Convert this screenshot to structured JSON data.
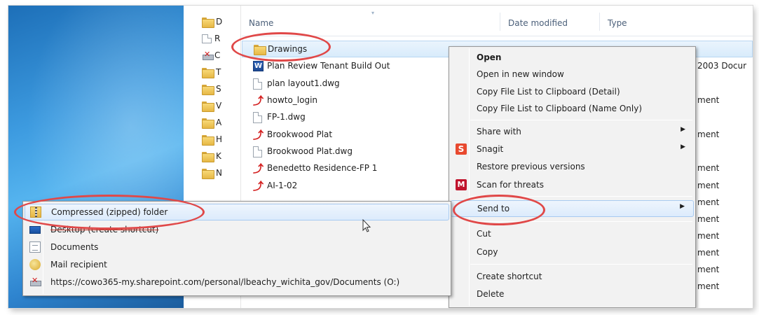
{
  "file_list": {
    "columns": {
      "name": "Name",
      "date_modified": "Date modified",
      "type": "Type"
    },
    "rows": [
      {
        "icon": "folder-icon",
        "name": "Drawings",
        "type": ""
      },
      {
        "icon": "word-icon",
        "name": "Plan Review Tenant Build Out",
        "type": "2003 Docur"
      },
      {
        "icon": "file-icon",
        "name": "plan layout1.dwg",
        "type": ""
      },
      {
        "icon": "pdf-icon",
        "name": "howto_login",
        "type": "ment"
      },
      {
        "icon": "file-icon",
        "name": "FP-1.dwg",
        "type": ""
      },
      {
        "icon": "pdf-icon",
        "name": "Brookwood Plat",
        "type": "ment"
      },
      {
        "icon": "file-icon",
        "name": "Brookwood Plat.dwg",
        "type": ""
      },
      {
        "icon": "pdf-icon",
        "name": "Benedetto Residence-FP 1",
        "type": "ment"
      },
      {
        "icon": "pdf-icon",
        "name": "AI-1-02",
        "type": "ment"
      }
    ],
    "extra_type_fragments": [
      "ment",
      "ment",
      "ment",
      "ment",
      "ment",
      "ment"
    ]
  },
  "nav_pane": {
    "items": [
      {
        "icon": "downloads-folder-icon",
        "label": "D"
      },
      {
        "icon": "recent-places-icon",
        "label": "R"
      },
      {
        "icon": "network-drive-icon",
        "label": "C"
      },
      {
        "icon": "folder-icon",
        "label": "T"
      },
      {
        "icon": "folder-icon",
        "label": "S"
      },
      {
        "icon": "folder-icon",
        "label": "V"
      },
      {
        "icon": "folder-icon",
        "label": "A"
      },
      {
        "icon": "folder-icon",
        "label": "H"
      },
      {
        "icon": "folder-icon",
        "label": "K"
      },
      {
        "icon": "folder-icon",
        "label": "N"
      }
    ]
  },
  "context_menu": {
    "items": [
      {
        "label": "Open",
        "bold": true
      },
      {
        "label": "Open in new window"
      },
      {
        "label": "Copy File List to Clipboard (Detail)"
      },
      {
        "label": "Copy File List to Clipboard (Name Only)"
      },
      {
        "label": "Share with",
        "submenu": true
      },
      {
        "label": "Snagit",
        "icon": "snagit-icon",
        "submenu": true
      },
      {
        "label": "Restore previous versions"
      },
      {
        "label": "Scan for threats",
        "icon": "mcafee-icon"
      },
      {
        "label": "Send to",
        "submenu": true,
        "highlighted": true
      },
      {
        "label": "Cut"
      },
      {
        "label": "Copy"
      },
      {
        "label": "Create shortcut"
      },
      {
        "label": "Delete"
      }
    ],
    "submenu_arrow": "▶"
  },
  "send_to_menu": {
    "items": [
      {
        "label": "Compressed (zipped) folder",
        "icon": "zip-folder-icon",
        "highlighted": true
      },
      {
        "label": "Desktop (create shortcut)",
        "icon": "desktop-icon"
      },
      {
        "label": "Documents",
        "icon": "documents-icon"
      },
      {
        "label": "Mail recipient",
        "icon": "mail-recipient-icon"
      },
      {
        "label": "https://cowo365-my.sharepoint.com/personal/lbeachy_wichita_gov/Documents (O:)",
        "icon": "network-drive-icon"
      }
    ]
  },
  "colors": {
    "annotation_red": "#e04848",
    "selection_blue": "#d8ebfb",
    "menu_bg": "#f2f2f2"
  }
}
